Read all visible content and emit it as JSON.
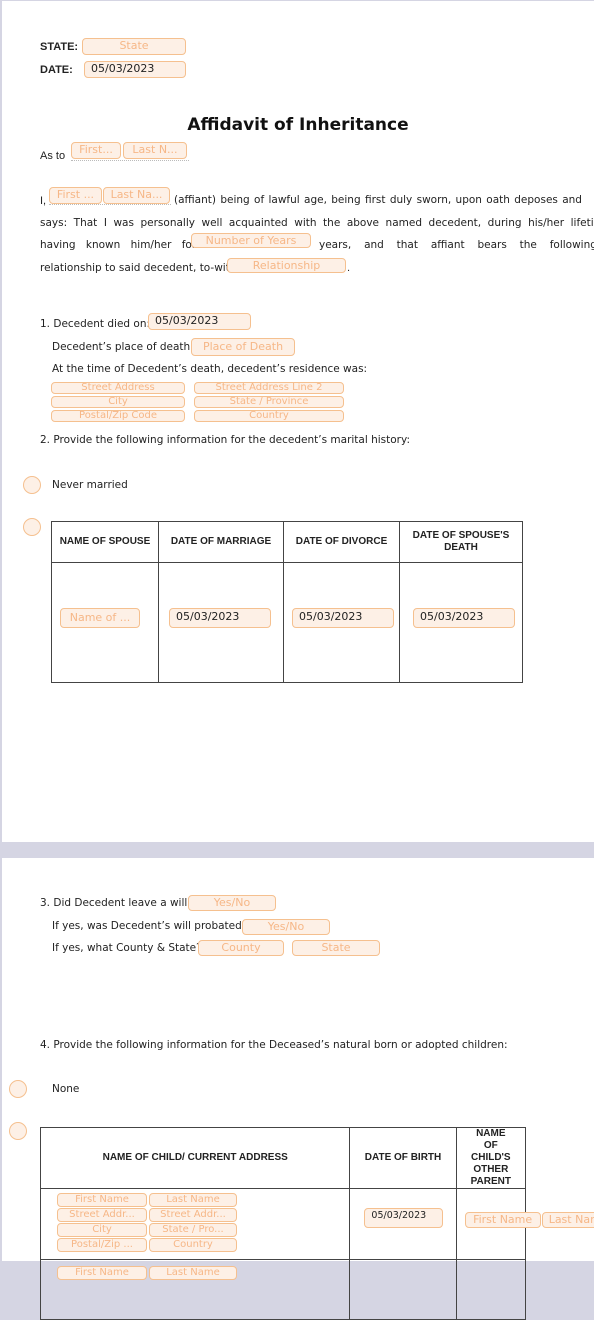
{
  "document": {
    "title": "Affidavit of Inheritance",
    "accent_color": "#f5c08f",
    "field_fill": "#fdf0e6"
  },
  "header": {
    "state_label": "STATE:",
    "state_placeholder": "State",
    "date_label": "DATE:",
    "date_value": "05/03/2023"
  },
  "as_to": {
    "label": "As to",
    "first_placeholder": "First...",
    "last_placeholder": "Last N..."
  },
  "affiant": {
    "prefix": "I,",
    "first_placeholder": "First ...",
    "last_placeholder": "Last Na...",
    "text1": "(affiant) being of lawful age, being first duly sworn, upon oath deposes and says: That I was personally well acquainted with the above named decedent, during his/her lifetime, having known him/her for",
    "years_placeholder": "Number of Years",
    "text2": "years, and that affiant bears the following relationship to said decedent, to-wit:",
    "relationship_placeholder": "Relationship",
    "suffix": "."
  },
  "section1": {
    "died_on_label": "1. Decedent died on:",
    "died_on_value": "05/03/2023",
    "place_label": "Decedent’s place of death:",
    "place_placeholder": "Place of Death",
    "residence_label": "At the time of Decedent’s death, decedent’s residence was:",
    "address": {
      "street": "Street Address",
      "street2": "Street Address Line 2",
      "city": "City",
      "state": "State / Province",
      "zip": "Postal/Zip Code",
      "country": "Country"
    }
  },
  "section2": {
    "label": "2. Provide the following information for the decedent’s marital history:",
    "never_married": "Never married",
    "table": {
      "headers": [
        "NAME OF SPOUSE",
        "DATE OF MARRIAGE",
        "DATE OF DIVORCE",
        "DATE OF SPOUSE'S DEATH"
      ],
      "row": {
        "spouse_placeholder": "Name of ...",
        "marriage_date": "05/03/2023",
        "divorce_date": "05/03/2023",
        "death_date": "05/03/2023"
      }
    }
  },
  "section3": {
    "will_label": "3. Did Decedent leave a will?",
    "will_placeholder": "Yes/No",
    "probated_label": "If yes, was Decedent’s will probated?",
    "probated_placeholder": "Yes/No",
    "county_label": "If yes, what County & State?",
    "county_placeholder": "County",
    "state_placeholder": "State"
  },
  "section4": {
    "label": "4. Provide the following information for the Deceased’s natural born or adopted children:",
    "none": "None",
    "table": {
      "headers": [
        "NAME OF CHILD/ CURRENT ADDRESS",
        "DATE OF BIRTH",
        "NAME OF CHILD'S OTHER PARENT"
      ],
      "rows": [
        {
          "first": "First Name",
          "last": "Last Name",
          "street": "Street Addr...",
          "street2": "Street Addr...",
          "city": "City",
          "state": "State / Pro...",
          "zip": "Postal/Zip ...",
          "country": "Country",
          "dob": "05/03/2023",
          "parent_first": "First Name",
          "parent_last": "Last Name"
        },
        {
          "first": "First Name",
          "last": "Last Name"
        }
      ]
    }
  }
}
